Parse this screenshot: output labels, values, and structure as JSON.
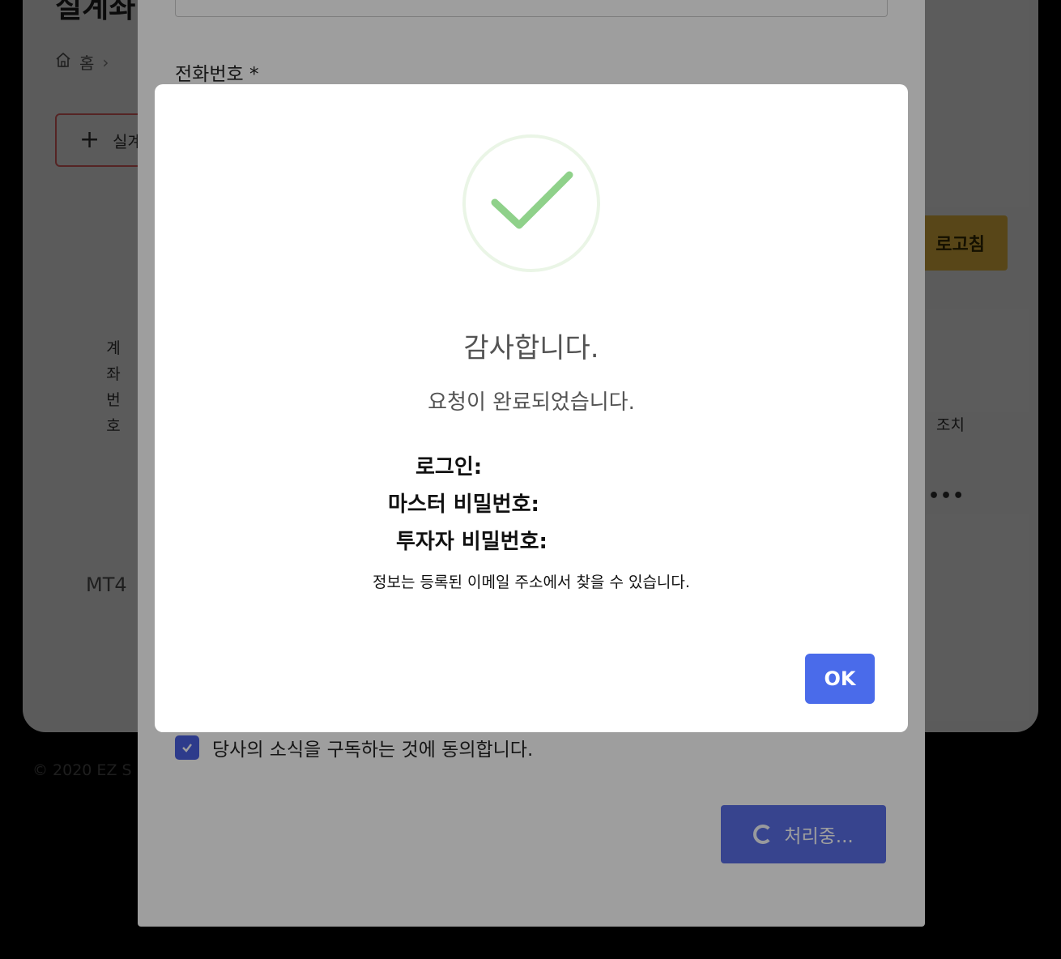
{
  "background": {
    "page_title": "실계좌",
    "breadcrumb": {
      "home": "홈",
      "separator": "›"
    },
    "add_button": {
      "icon": "plus-icon",
      "label": "실계좌"
    },
    "refresh_button": "로고침",
    "table": {
      "col_account": "계좌번호",
      "col_action": "조치",
      "row_platform": "MT4",
      "row_more": "•••"
    },
    "copyright": "© 2020 EZ S"
  },
  "form_modal": {
    "phone_label": "전화번호 *",
    "agree_label": "당사의 소식을 구독하는 것에 동의합니다.",
    "agree_checked": true,
    "processing_label": "처리중..."
  },
  "dialog": {
    "icon": "checkmark-icon",
    "title": "감사합니다.",
    "subtitle": "요청이 완료되었습니다.",
    "login_label": "로그인:",
    "master_password_label": "마스터 비밀번호:",
    "investor_password_label": "투자자 비밀번호:",
    "note": "정보는 등록된 이메일 주소에서 찾을 수 있습니다.",
    "ok_label": "OK"
  },
  "colors": {
    "accent_blue": "#4a6bea",
    "success_green": "#8fd18a",
    "refresh_yellow": "#f6c544"
  }
}
